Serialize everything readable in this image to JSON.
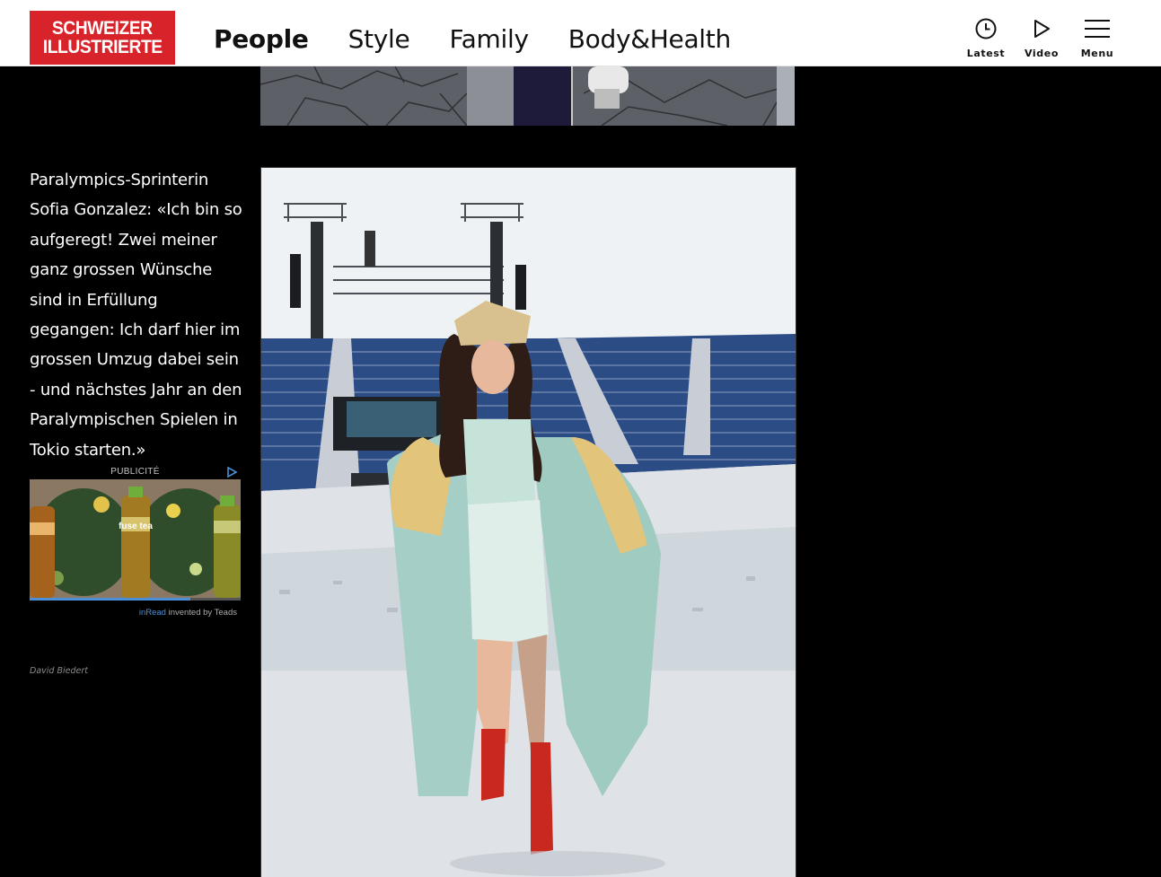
{
  "header": {
    "logo_line1": "SCHWEIZER",
    "logo_line2": "ILLUSTRIERTE",
    "nav": [
      {
        "label": "People",
        "active": true
      },
      {
        "label": "Style",
        "active": false
      },
      {
        "label": "Family",
        "active": false
      },
      {
        "label": "Body&Health",
        "active": false
      }
    ],
    "tools": {
      "latest": "Latest",
      "video": "Video",
      "menu": "Menu"
    }
  },
  "article": {
    "caption": "Paralympics-Sprinterin Sofia Gonzalez: «Ich bin so aufgeregt! Zwei meiner ganz grossen Wünsche sind in Erfüllung gegangen: Ich darf hier im grossen Umzug dabei sein - und nächstes Jahr an den Paralympischen Spielen in Tokio starten.»",
    "photo_credit": "David Biedert"
  },
  "ad": {
    "label": "PUBLICITÉ",
    "product": "fuse tea",
    "footer_brand": "inRead",
    "footer_text": " invented by Teads",
    "progress": 0.76
  },
  "colors": {
    "brand_red": "#d8232a",
    "page_background": "#000000",
    "header_background": "#ffffff",
    "ad_accent": "#4a90d9"
  }
}
